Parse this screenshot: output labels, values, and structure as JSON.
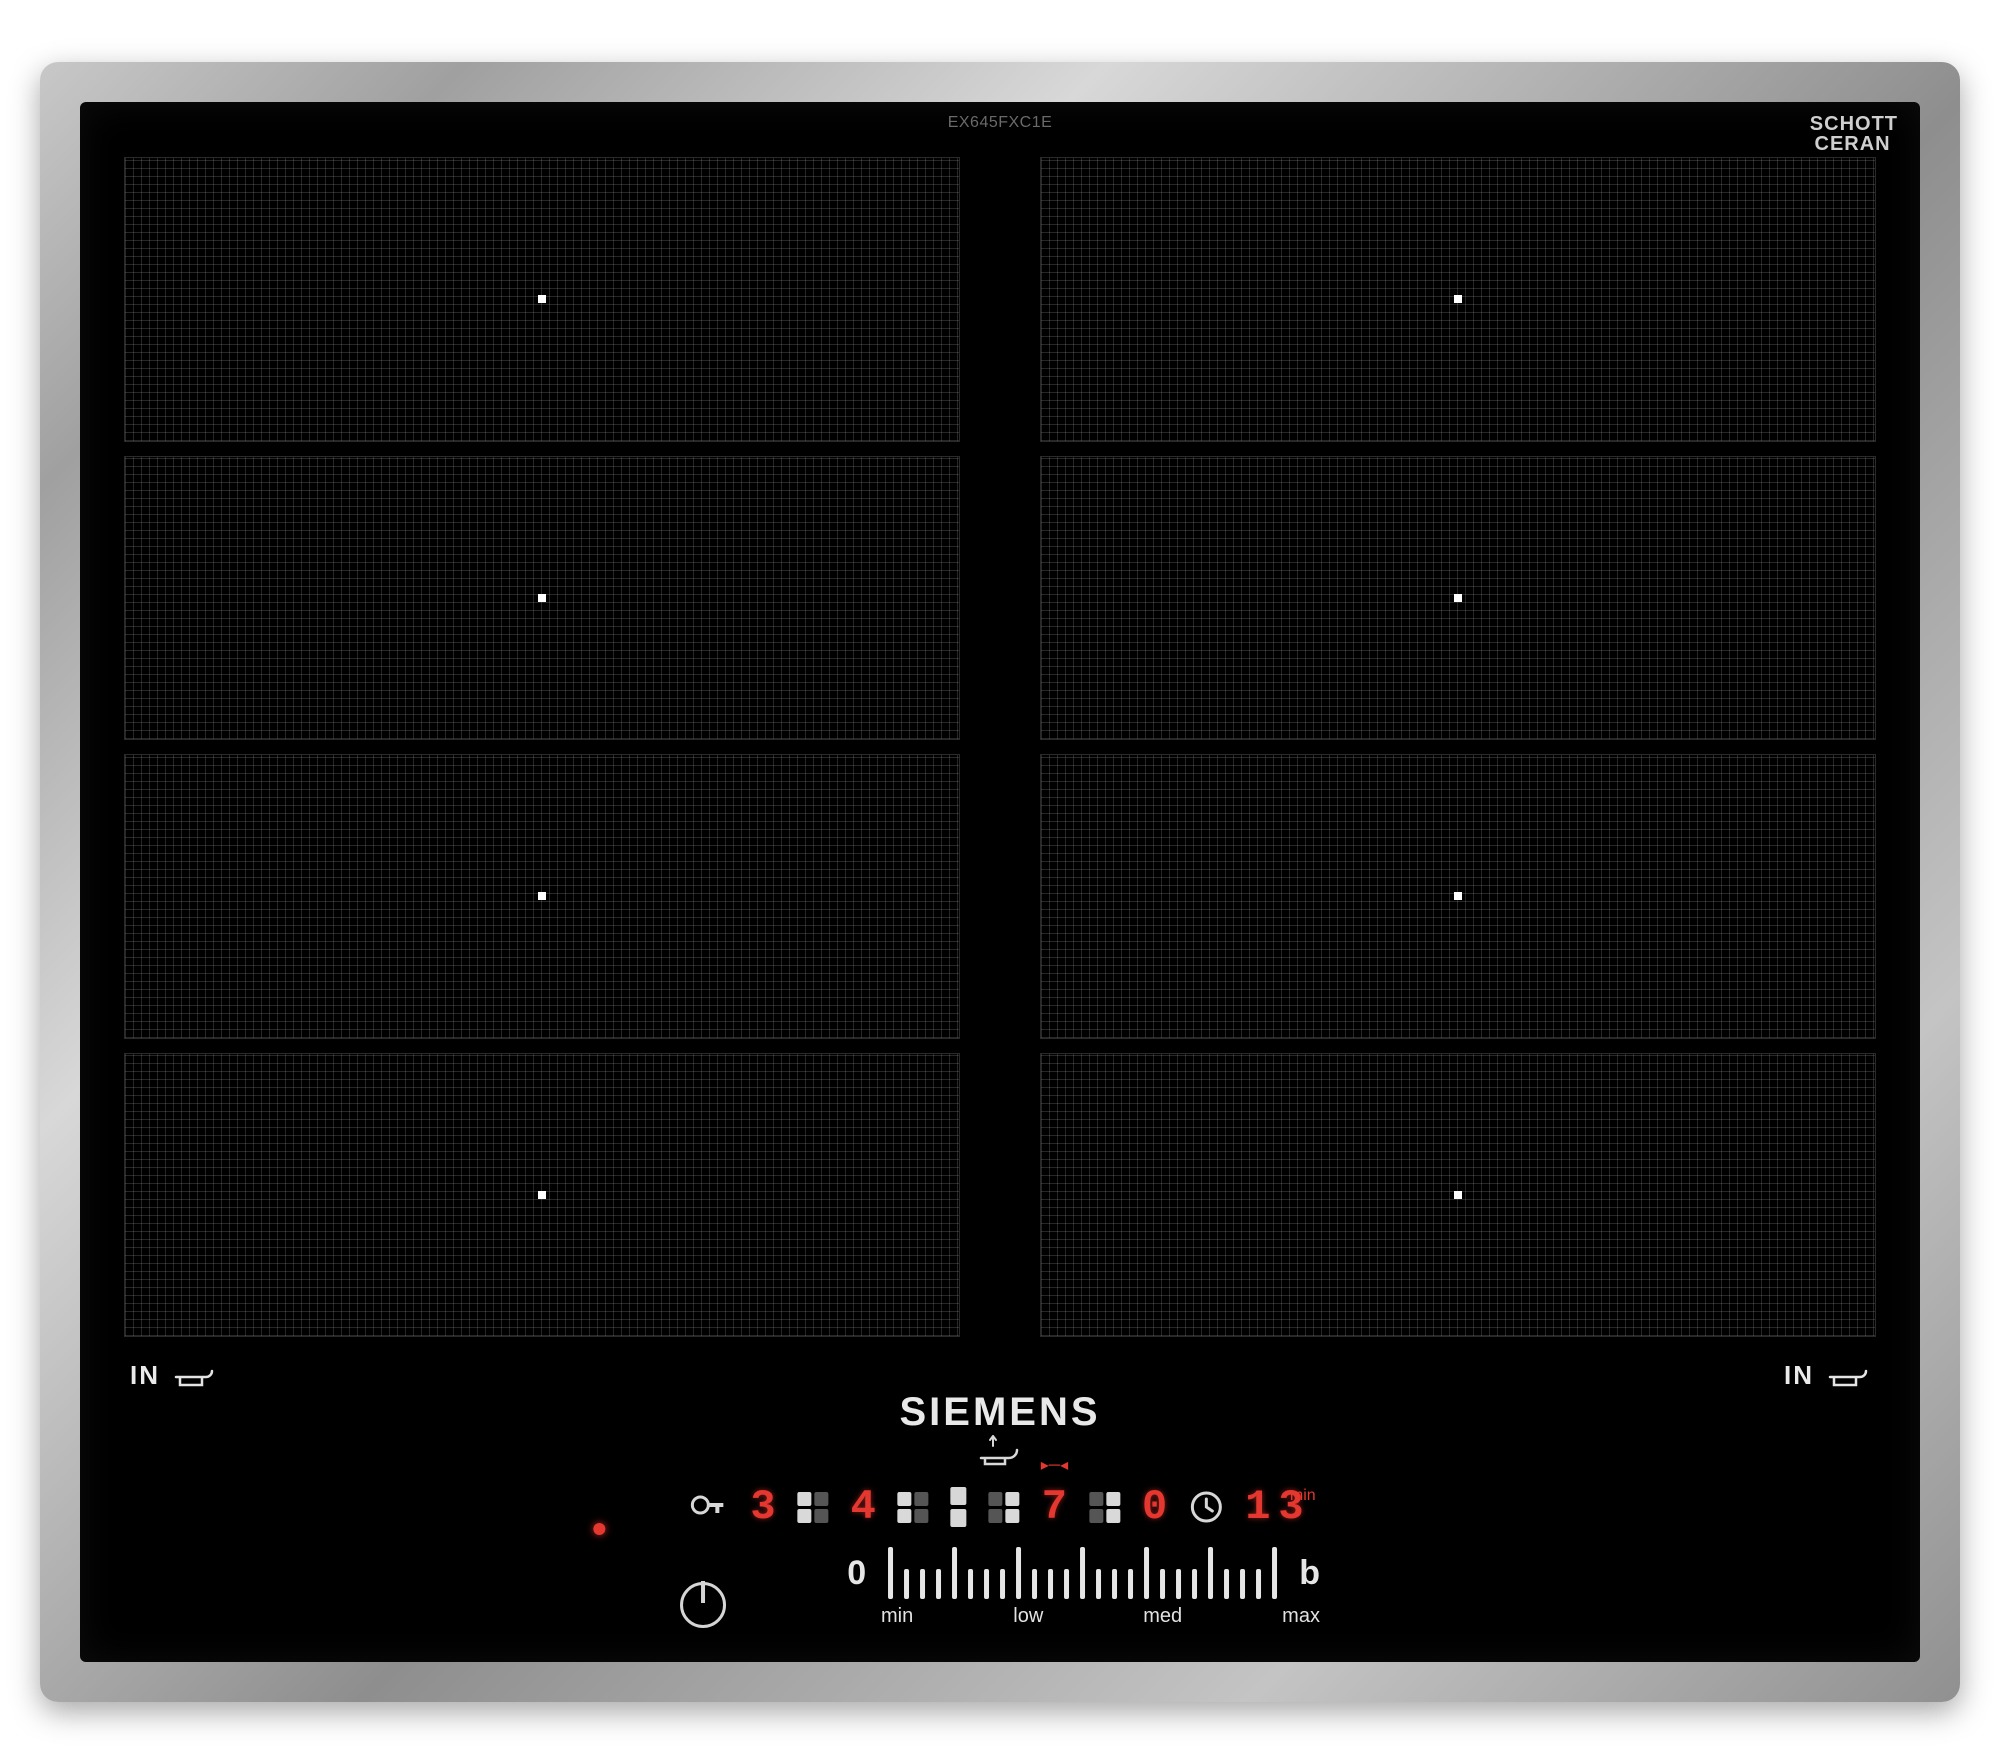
{
  "model_number": "EX645FXC1E",
  "cert": {
    "line1": "SCHOTT",
    "line2": "CERAN",
    "reg": "®"
  },
  "zone_marker": "IN",
  "brand": "SIEMENS",
  "display": {
    "zone1_level": "3",
    "zone2_level": "4",
    "zone3_level": "7",
    "zone4_level": "0",
    "timer_value": "13",
    "timer_unit": "min"
  },
  "slider": {
    "zero": "0",
    "boost": "b",
    "labels": [
      "min",
      "low",
      "med",
      "max"
    ]
  }
}
